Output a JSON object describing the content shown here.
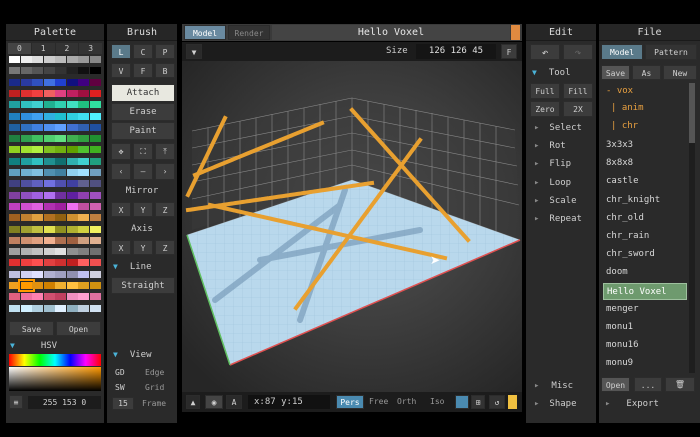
{
  "palette": {
    "title": "Palette",
    "tabs": [
      "0",
      "1",
      "2",
      "3"
    ],
    "save": "Save",
    "open": "Open",
    "hsv": "HSV",
    "rgb": "255 153 0",
    "menu": "≡"
  },
  "brush": {
    "title": "Brush",
    "modes": [
      "L",
      "C",
      "P",
      "V",
      "F",
      "B"
    ],
    "attach": "Attach",
    "erase": "Erase",
    "paint": "Paint",
    "mirror": "Mirror",
    "axis": "Axis",
    "xyz": [
      "X",
      "Y",
      "Z"
    ],
    "line": "Line",
    "straight": "Straight",
    "view": "View",
    "gd": "GD",
    "edge": "Edge",
    "sw": "SW",
    "grid": "Grid",
    "fps": "15",
    "frame": "Frame"
  },
  "viewport": {
    "tab_model": "Model",
    "tab_render": "Render",
    "filename": "Hello Voxel",
    "size_label": "Size",
    "size_value": "126 126 45",
    "f": "F",
    "coords_x": "x:87",
    "coords_y": "y:15",
    "a": "A",
    "pers": "Pers",
    "free": "Free",
    "orth": "Orth",
    "iso": "Iso"
  },
  "edit": {
    "title": "Edit",
    "tool": "Tool",
    "full": "Full",
    "fill": "Fill",
    "zero": "Zero",
    "x2": "2X",
    "items": [
      "Select",
      "Rot",
      "Flip",
      "Loop",
      "Scale",
      "Repeat"
    ],
    "misc": "Misc",
    "shape": "Shape"
  },
  "file": {
    "title": "File",
    "tab_model": "Model",
    "tab_pattern": "Pattern",
    "save": "Save",
    "as": "As",
    "new": "New",
    "tree": [
      "- vox",
      "| anim",
      "| chr"
    ],
    "files": [
      "3x3x3",
      "8x8x8",
      "castle",
      "chr_knight",
      "chr_old",
      "chr_rain",
      "chr_sword",
      "doom",
      "Hello Voxel",
      "menger",
      "monu1",
      "monu16",
      "monu9"
    ],
    "selected": "Hello Voxel",
    "open": "Open",
    "dots": "...",
    "export": "Export"
  },
  "colors": {
    "accent": "#4ab3d8",
    "voxel": "#e8a030",
    "floor": "#b8d8ec",
    "selected": "#6e9a6e"
  }
}
